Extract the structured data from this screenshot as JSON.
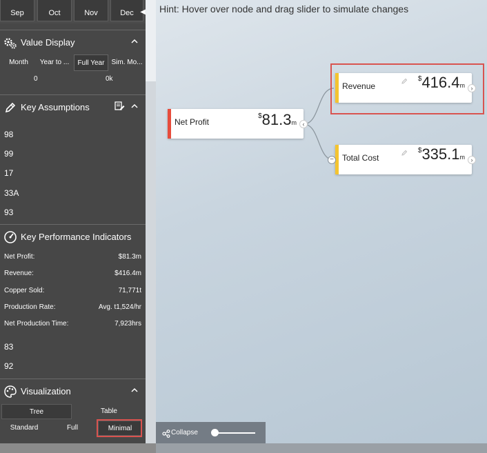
{
  "months": [
    "Sep",
    "Oct",
    "Nov",
    "Dec"
  ],
  "value_display": {
    "title": "Value Display",
    "options": [
      "Month",
      "Year to ...",
      "Full Year",
      "Sim. Mo..."
    ],
    "selected": "Full Year",
    "sub_values": [
      "0",
      "0k"
    ]
  },
  "key_assumptions": {
    "title": "Key Assumptions",
    "items": [
      "98",
      "99",
      "17",
      "33A",
      "93"
    ]
  },
  "kpi": {
    "title": "Key Performance Indicators",
    "rows": [
      {
        "label": "Net Profit:",
        "value": "$81.3m"
      },
      {
        "label": "Revenue:",
        "value": "$416.4m"
      },
      {
        "label": "Copper Sold:",
        "value": "71,771t"
      },
      {
        "label": "Production Rate:",
        "value": "Avg. t1,524/hr"
      },
      {
        "label": "Net Production Time:",
        "value": "7,923hrs"
      }
    ],
    "extra": [
      "83",
      "92"
    ]
  },
  "visualization": {
    "title": "Visualization",
    "view_options": [
      "Tree",
      "Table"
    ],
    "view_selected": "Tree",
    "detail_options": [
      "Standard",
      "Full",
      "Minimal"
    ],
    "detail_selected": "Minimal"
  },
  "main": {
    "hint": "Hint: Hover over node and drag slider to simulate changes",
    "nodes": {
      "net_profit": {
        "label": "Net Profit",
        "currency": "$",
        "value": "81.3",
        "unit": "m",
        "bar_color": "#e74c3c"
      },
      "revenue": {
        "label": "Revenue",
        "currency": "$",
        "value": "416.4",
        "unit": "m",
        "bar_color": "#f4c430"
      },
      "total_cost": {
        "label": "Total Cost",
        "currency": "$",
        "value": "335.1",
        "unit": "m",
        "bar_color": "#f4c430"
      }
    },
    "collapse_label": "Collapse",
    "slider_value": 0
  },
  "colors": {
    "sidebar": "#474747",
    "highlight": "#d9534f",
    "accent_yellow": "#f4c430",
    "accent_red": "#e74c3c"
  }
}
